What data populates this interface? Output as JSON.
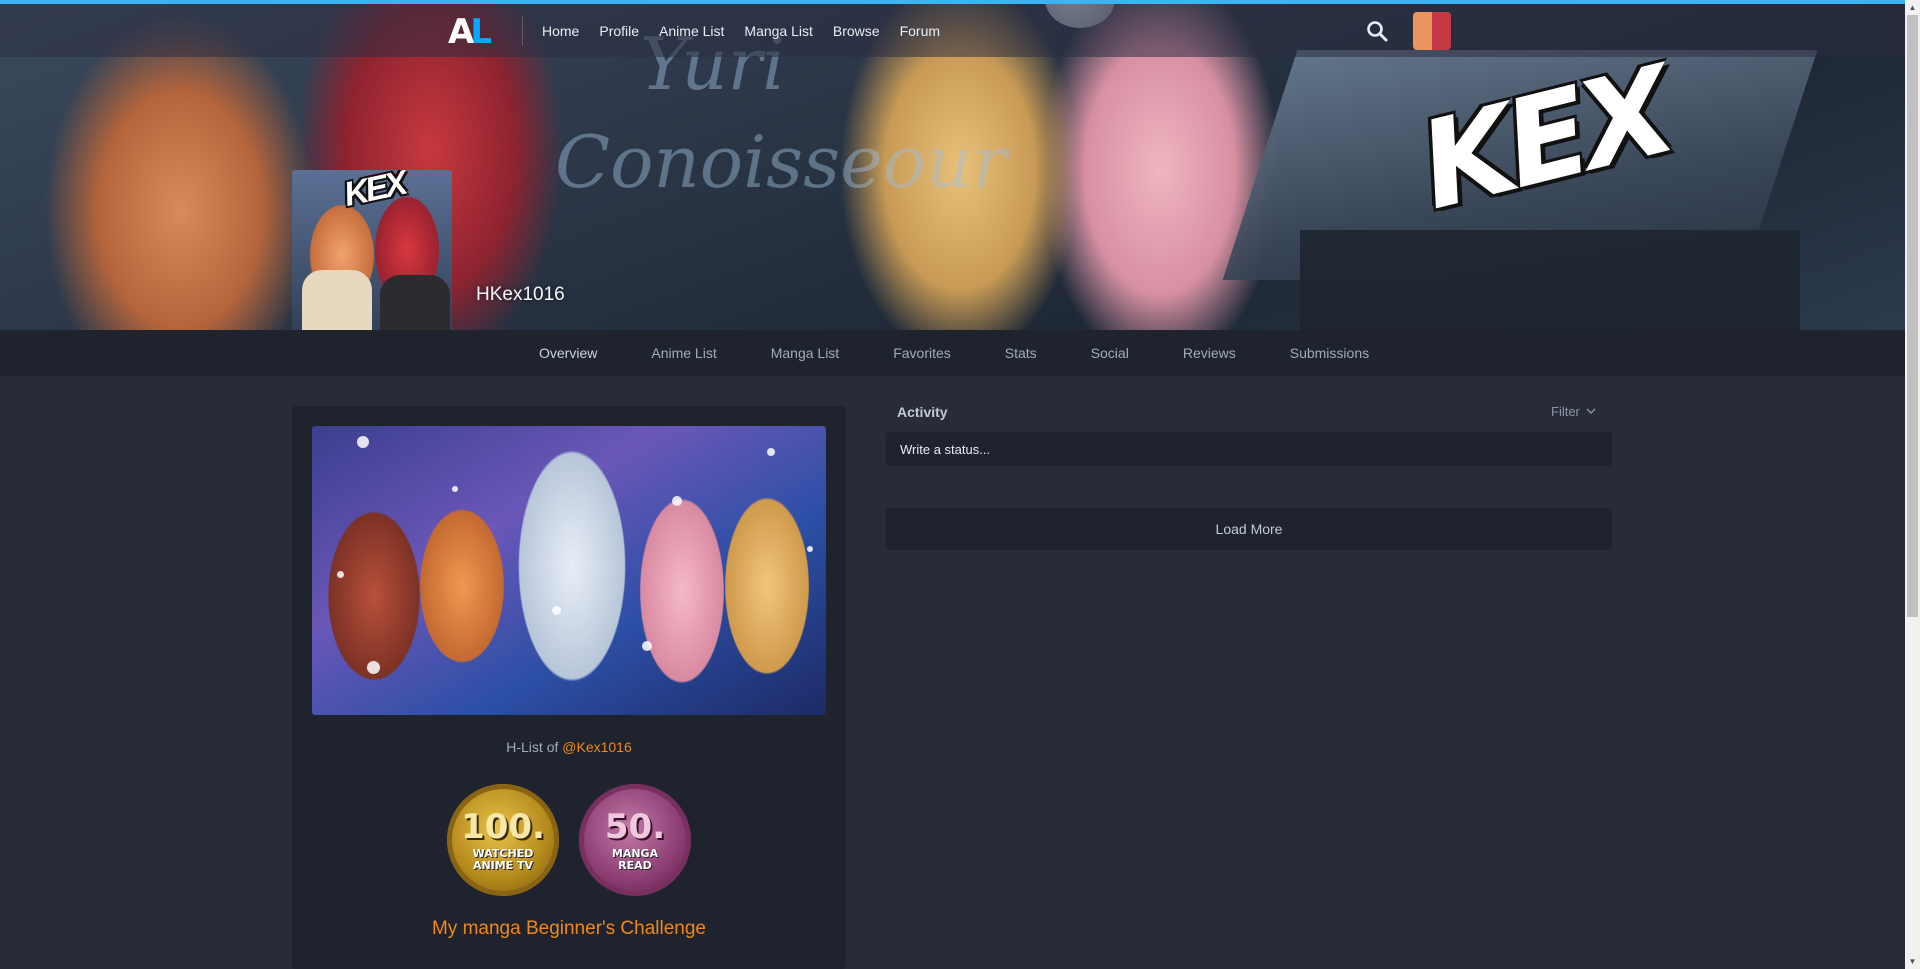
{
  "banner": {
    "bg_text_line1": "Yuri",
    "bg_text_line2": "Conoisseour",
    "logo_text": "KEX"
  },
  "nav": {
    "logo_a": "A",
    "logo_l": "L",
    "links": [
      "Home",
      "Profile",
      "Anime List",
      "Manga List",
      "Browse",
      "Forum"
    ],
    "search_icon": "search-icon",
    "accent_color": "#3db4f2"
  },
  "profile": {
    "username": "HKex1016",
    "avatar_text": "KEX"
  },
  "subnav": {
    "tabs": [
      "Overview",
      "Anime List",
      "Manga List",
      "Favorites",
      "Stats",
      "Social",
      "Reviews",
      "Submissions"
    ]
  },
  "about": {
    "list_text": "H-List of ",
    "mention": "@Kex1016",
    "badges": [
      {
        "number": "100.",
        "label_line1": "WATCHED",
        "label_line2": "ANIME TV"
      },
      {
        "number": "50.",
        "label_line1": "MANGA",
        "label_line2": "READ"
      }
    ],
    "challenge": "My manga Beginner's Challenge"
  },
  "activity": {
    "title": "Activity",
    "filter_label": "Filter",
    "status_placeholder": "Write a status...",
    "load_more": "Load More"
  }
}
